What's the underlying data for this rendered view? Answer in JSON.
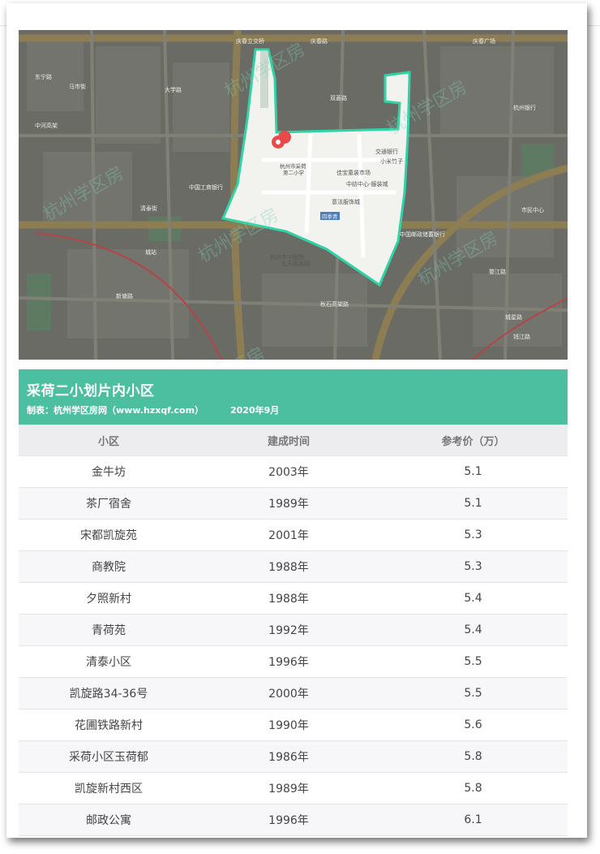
{
  "map": {
    "school_name": "杭州市采荷\n第二小学",
    "watermark": "杭州学区房",
    "labels": [
      "庆春立交桥",
      "庆春路",
      "庆春广场",
      "马市街",
      "大学路",
      "双菱路",
      "中国工商银行",
      "清泰街",
      "城站",
      "中河高架",
      "交通银行",
      "小米竹子",
      "佳宝童装市场",
      "中纺中心-服装城",
      "意法服饰城",
      "四季青",
      "中国邮政储蓄银行",
      "杭州市中医院",
      "九天服装网",
      "秋石高架路",
      "市民中心",
      "钱江路",
      "城星路",
      "婺江路",
      "杭州银行",
      "东宁路",
      "新塘路"
    ]
  },
  "banner": {
    "title": "采荷二小划片内小区",
    "credit": "制表：杭州学区房网（www.hzxqf.com）",
    "date": "2020年9月"
  },
  "table": {
    "headers": [
      "小区",
      "建成时间",
      "参考价（万）"
    ],
    "rows": [
      [
        "金牛坊",
        "2003年",
        "5.1"
      ],
      [
        "茶厂宿舍",
        "1989年",
        "5.1"
      ],
      [
        "宋都凯旋苑",
        "2001年",
        "5.3"
      ],
      [
        "商教院",
        "1988年",
        "5.3"
      ],
      [
        "夕照新村",
        "1988年",
        "5.4"
      ],
      [
        "青荷苑",
        "1992年",
        "5.4"
      ],
      [
        "清泰小区",
        "1996年",
        "5.5"
      ],
      [
        "凯旋路34-36号",
        "2000年",
        "5.5"
      ],
      [
        "花圃铁路新村",
        "1990年",
        "5.6"
      ],
      [
        "采荷小区玉荷郁",
        "1986年",
        "5.8"
      ],
      [
        "凯旋新村西区",
        "1989年",
        "5.8"
      ],
      [
        "邮政公寓",
        "1996年",
        "6.1"
      ]
    ]
  },
  "colors": {
    "banner": "#4bbfa0",
    "boundary": "#2fd3a6",
    "map_dark": "#6c6c66",
    "pin": "#e84a4a"
  }
}
